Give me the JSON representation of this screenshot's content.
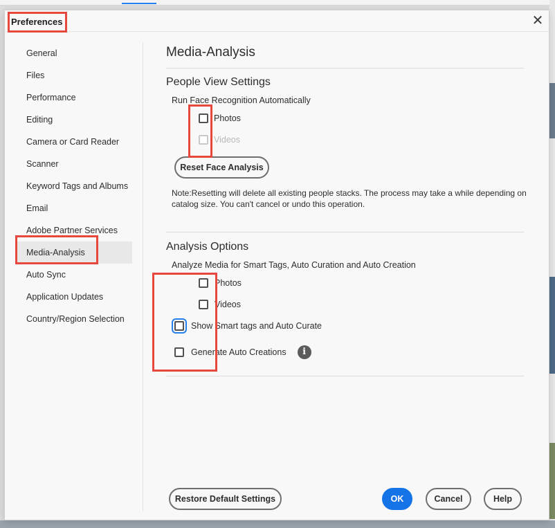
{
  "dialog": {
    "title": "Preferences",
    "close_glyph": "✕"
  },
  "sidebar": {
    "items": [
      {
        "label": "General"
      },
      {
        "label": "Files"
      },
      {
        "label": "Performance"
      },
      {
        "label": "Editing"
      },
      {
        "label": "Camera or Card Reader"
      },
      {
        "label": "Scanner"
      },
      {
        "label": "Keyword Tags and Albums"
      },
      {
        "label": "Email"
      },
      {
        "label": "Adobe Partner Services"
      },
      {
        "label": "Media-Analysis",
        "active": true
      },
      {
        "label": "Auto Sync"
      },
      {
        "label": "Application Updates"
      },
      {
        "label": "Country/Region Selection"
      }
    ]
  },
  "main": {
    "page_title": "Media-Analysis",
    "people": {
      "heading": "People View Settings",
      "run_label": "Run Face Recognition Automatically",
      "photos_label": "Photos",
      "videos_label": "Videos",
      "reset_button": "Reset Face Analysis",
      "note_line1": "Note:Resetting will delete all existing people stacks. The process may take a while depending on",
      "note_line2": "catalog size. You can't cancel or undo this operation."
    },
    "analysis": {
      "heading": "Analysis Options",
      "analyze_label": "Analyze Media for Smart Tags, Auto Curation and Auto Creation",
      "photos_label": "Photos",
      "videos_label": "Videos",
      "smart_tags_label": "Show Smart tags and Auto Curate",
      "auto_creations_label": "Generate Auto Creations",
      "info_glyph": "i"
    }
  },
  "footer": {
    "restore_button": "Restore Default Settings",
    "ok_button": "OK",
    "cancel_button": "Cancel",
    "help_button": "Help"
  },
  "colors": {
    "accent": "#1473e6",
    "highlight": "#e8473e"
  }
}
